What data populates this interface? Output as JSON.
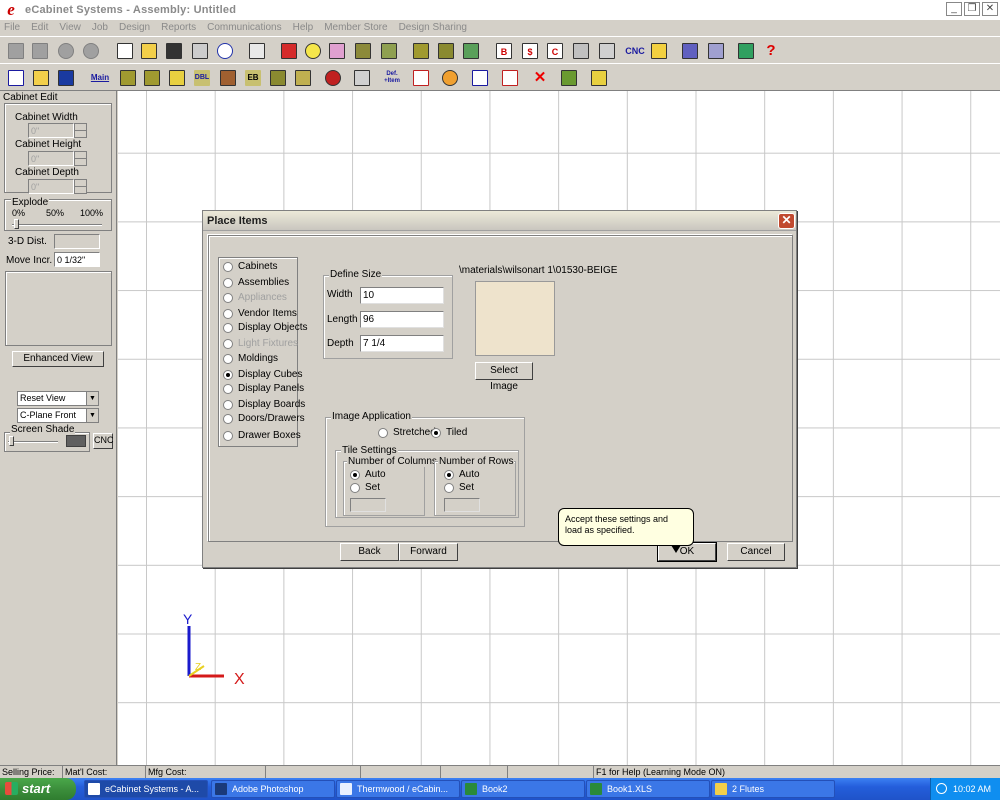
{
  "window": {
    "title": "eCabinet Systems - Assembly: Untitled",
    "controls": [
      "minimize",
      "restore",
      "close"
    ]
  },
  "menu": [
    "File",
    "Edit",
    "View",
    "Job",
    "Design",
    "Reports",
    "Communications",
    "Help",
    "Member Store",
    "Design Sharing"
  ],
  "toolbar1": {
    "cnc_label": "CNC",
    "help_label": "?"
  },
  "toolbar2": {
    "main_label": "Main",
    "def_item_label": "Def. +Item",
    "dbl_label": "DBL",
    "eb_label": "EB"
  },
  "left_panel": {
    "title": "Cabinet Edit",
    "cabinet_width_label": "Cabinet Width",
    "cabinet_width_value": "0\"",
    "cabinet_height_label": "Cabinet Height",
    "cabinet_height_value": "0\"",
    "cabinet_depth_label": "Cabinet Depth",
    "cabinet_depth_value": "0\"",
    "explode_label": "Explode",
    "explode_ticks": [
      "0%",
      "50%",
      "100%"
    ],
    "dist_3d_label": "3-D Dist.",
    "move_incr_label": "Move Incr.",
    "move_incr_value": "0 1/32\"",
    "enhanced_view_label": "Enhanced View",
    "view_select": "Reset View",
    "plane_select": "C-Plane Front",
    "screen_shade_label": "Screen Shade",
    "cnc_label": "CNC"
  },
  "axes": {
    "y": "Y",
    "x": "X",
    "z": "Z"
  },
  "dialog": {
    "title": "Place Items",
    "close_label": "✕",
    "item_types": [
      {
        "label": "Cabinets",
        "selected": false,
        "enabled": true
      },
      {
        "label": "Assemblies",
        "selected": false,
        "enabled": true
      },
      {
        "label": "Appliances",
        "selected": false,
        "enabled": false
      },
      {
        "label": "Vendor Items",
        "selected": false,
        "enabled": true
      },
      {
        "label": "Display Objects",
        "selected": false,
        "enabled": true
      },
      {
        "label": "Light Fixtures",
        "selected": false,
        "enabled": false
      },
      {
        "label": "Moldings",
        "selected": false,
        "enabled": true
      },
      {
        "label": "Display Cubes",
        "selected": true,
        "enabled": true
      },
      {
        "label": "Display Panels",
        "selected": false,
        "enabled": true
      },
      {
        "label": "Display Boards",
        "selected": false,
        "enabled": true
      },
      {
        "label": "Doors/Drawers",
        "selected": false,
        "enabled": true
      },
      {
        "label": "Drawer Boxes",
        "selected": false,
        "enabled": true
      }
    ],
    "define_size": {
      "title": "Define Size",
      "width_label": "Width",
      "width_value": "10",
      "length_label": "Length",
      "length_value": "96",
      "depth_label": "Depth",
      "depth_value": "7 1/4"
    },
    "material_path": "\\materials\\wilsonart 1\\01530-BEIGE",
    "swatch_color": "#eee3cc",
    "select_image_label": "Select Image",
    "image_application": {
      "title": "Image Application",
      "stretched_label": "Stretched",
      "tiled_label": "Tiled",
      "tiled_selected": true
    },
    "tile_settings": {
      "title": "Tile Settings",
      "columns_title": "Number of Columns",
      "rows_title": "Number of Rows",
      "auto_label": "Auto",
      "set_label": "Set"
    },
    "back_label": "Back",
    "forward_label": "Forward",
    "ok_label": "OK",
    "cancel_label": "Cancel",
    "tooltip": "Accept these settings and load as specified."
  },
  "status": {
    "selling_price_label": "Selling Price:",
    "matl_cost_label": "Mat'l Cost:",
    "mfg_cost_label": "Mfg Cost:",
    "help_hint": "F1 for Help (Learning Mode ON)"
  },
  "taskbar": {
    "start_label": "start",
    "tasks": [
      "eCabinet Systems - A...",
      "Adobe Photoshop",
      "Thermwood / eCabin...",
      "Book2",
      "Book1.XLS",
      "2 Flutes"
    ],
    "clock": "10:02 AM"
  }
}
